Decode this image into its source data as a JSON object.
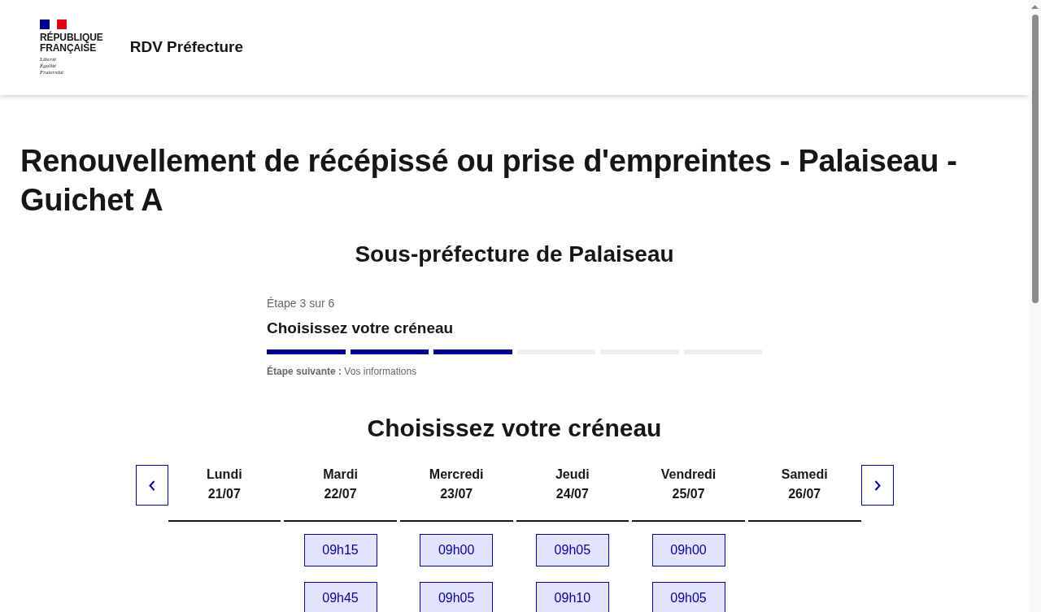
{
  "header": {
    "logo": {
      "name": "RÉPUBLIQUE FRANÇAISE",
      "motto": "Liberté Égalité Fraternité"
    },
    "service_name": "RDV Préfecture"
  },
  "page_title": "Renouvellement de récépissé ou prise d'empreintes - Palaiseau - Guichet A",
  "subtitle": "Sous-préfecture de Palaiseau",
  "stepper": {
    "step_label": "Étape 3 sur 6",
    "title": "Choisissez votre créneau",
    "steps": [
      {
        "done": true
      },
      {
        "done": true
      },
      {
        "done": true
      },
      {
        "done": false
      },
      {
        "done": false
      },
      {
        "done": false
      }
    ],
    "next_step": "**Étape suivante :** Vos informations"
  },
  "calendar": {
    "heading": "Choisissez votre créneau",
    "days": [
      {
        "name": "Lundi",
        "date": "21/07"
      },
      {
        "name": "Mardi",
        "date": "22/07",
        "slots": [
          "09h15",
          "09h45"
        ]
      },
      {
        "name": "Mercredi",
        "date": "23/07",
        "slots": [
          "09h00",
          "09h05"
        ]
      },
      {
        "name": "Jeudi",
        "date": "24/07",
        "slots": [
          "09h05",
          "09h10"
        ]
      },
      {
        "name": "Vendredi",
        "date": "25/07",
        "slots": [
          "09h00",
          "09h05"
        ]
      },
      {
        "name": "Samedi",
        "date": "26/07"
      }
    ]
  }
}
